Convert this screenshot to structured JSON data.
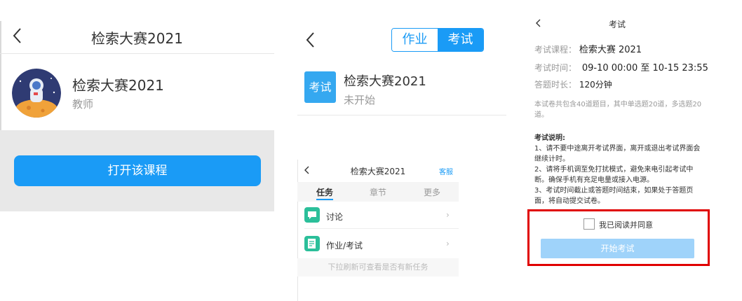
{
  "panel1": {
    "title": "检索大赛2021",
    "course_name": "检索大赛2021",
    "role": "教师",
    "open_button": "打开该课程"
  },
  "panel2": {
    "seg_homework": "作业",
    "seg_exam": "考试",
    "item_icon_label": "考试",
    "item_name": "检索大赛2021",
    "item_status": "未开始"
  },
  "panel3": {
    "title": "检索大赛2021",
    "service": "客服",
    "tabs": [
      "任务",
      "章节",
      "更多"
    ],
    "rows": [
      {
        "label": "讨论",
        "icon": "discussion-icon"
      },
      {
        "label": "作业/考试",
        "icon": "homework-icon"
      }
    ],
    "hint": "下拉刷新可查看是否有新任务"
  },
  "panel4": {
    "title": "考试",
    "course_key": "考试课程：",
    "course_val": "检索大赛 2021",
    "time_key": "考试时间：",
    "time_val": "09-10 00:00 至 10-15 23:55",
    "duration_key": "答题时长：",
    "duration_val": "120分钟",
    "note": "本试卷共包含40道题目，其中单选题20道，多选题20道。",
    "rules_heading": "考试说明:",
    "rule1": "1、请不要中途离开考试界面，离开或退出考试界面会继续计时。",
    "rule2": "2、请将手机调至免打扰模式，避免来电引起考试中断。确保手机有充足电量或接入电源。",
    "rule3": "3、考试时间截止或答题时间结束，如果处于答题页面，将自动提交试卷。",
    "agree_label": "我已阅读并同意",
    "start_button": "开始考试"
  },
  "colors": {
    "accent": "#1a9bf6",
    "exam_icon": "#35a8f0",
    "row_icon": "#2bbf9a",
    "start_disabled": "#9fd3fa",
    "highlight_box": "#e00000"
  }
}
